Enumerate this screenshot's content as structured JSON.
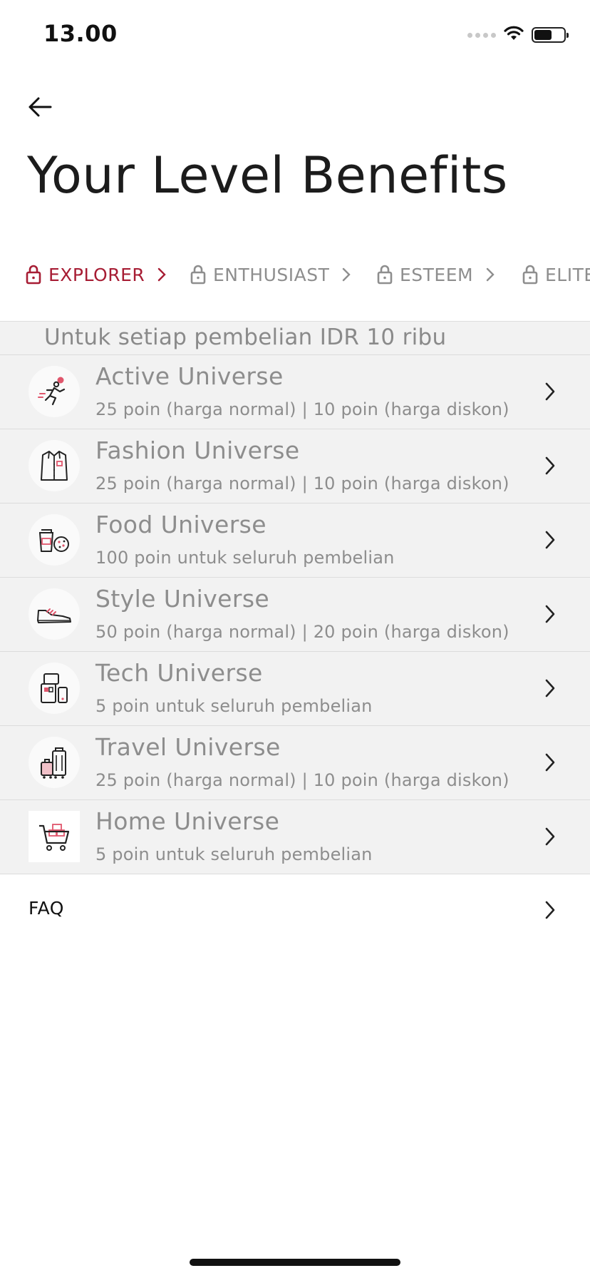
{
  "status_bar": {
    "time": "13.00"
  },
  "header": {
    "title": "Your Level Benefits"
  },
  "tiers": [
    {
      "label": "EXPLORER",
      "active": true
    },
    {
      "label": "ENTHUSIAST",
      "active": false
    },
    {
      "label": "ESTEEM",
      "active": false
    },
    {
      "label": "ELITE",
      "active": false
    }
  ],
  "benefits": {
    "header": "Untuk setiap pembelian IDR 10 ribu",
    "items": [
      {
        "title": "Active Universe",
        "subtitle": "25 poin (harga normal) | 10 poin (harga diskon)",
        "icon": "running-person-icon"
      },
      {
        "title": "Fashion Universe",
        "subtitle": "25 poin (harga normal) | 10 poin (harga diskon)",
        "icon": "shirt-icon"
      },
      {
        "title": "Food Universe",
        "subtitle": "100 poin untuk seluruh pembelian",
        "icon": "coffee-cookie-icon"
      },
      {
        "title": "Style Universe",
        "subtitle": "50 poin (harga normal) | 20 poin (harga diskon)",
        "icon": "sneaker-icon"
      },
      {
        "title": "Tech Universe",
        "subtitle": "5 poin untuk seluruh pembelian",
        "icon": "devices-icon"
      },
      {
        "title": "Travel Universe",
        "subtitle": "25 poin (harga normal) | 10 poin (harga diskon)",
        "icon": "luggage-icon"
      },
      {
        "title": "Home Universe",
        "subtitle": "5 poin untuk seluruh pembelian",
        "icon": "shopping-cart-icon"
      }
    ]
  },
  "faq": {
    "label": "FAQ"
  },
  "colors": {
    "accent": "#a71d34",
    "inactive_text": "#8e8e8e",
    "list_background": "#f2f2f2",
    "icon_accent": "#e0566c"
  }
}
